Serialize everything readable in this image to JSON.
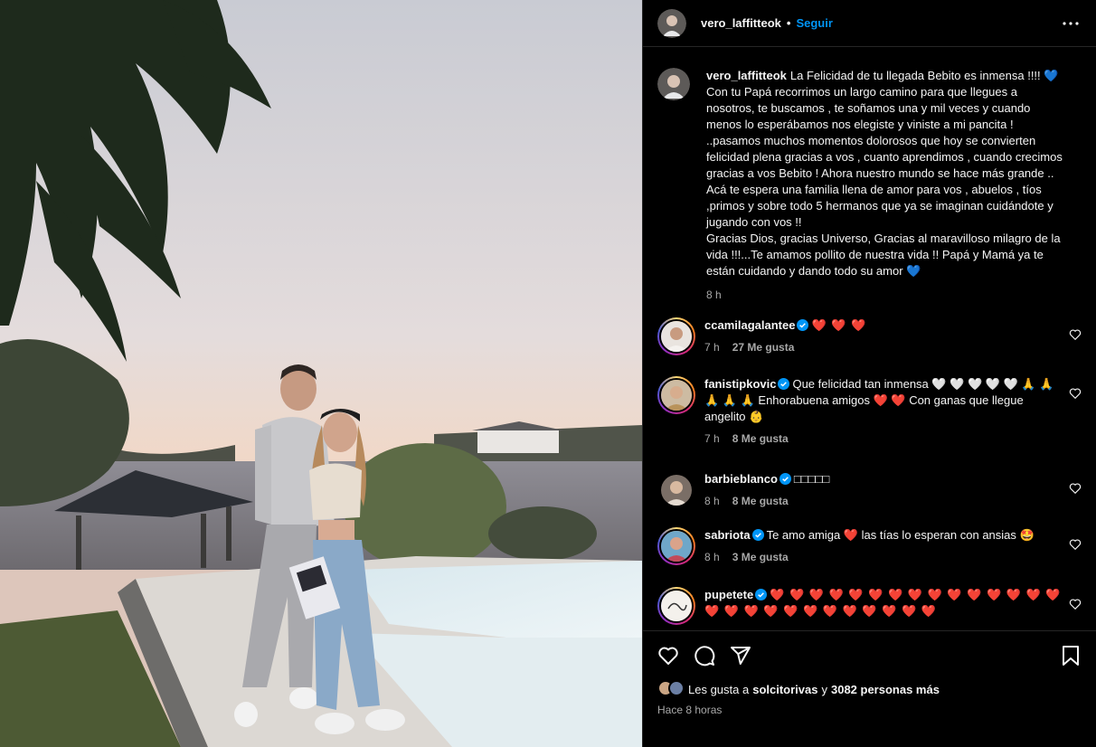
{
  "post": {
    "author": "vero_laffitteok",
    "follow_label": "Seguir",
    "separator": "•",
    "caption_lines": [
      "La Felicidad de tu llegada Bebito es inmensa !!!! 💙",
      "Con tu Papá recorrimos un largo camino para que llegues a",
      "nosotros, te buscamos , te soñamos una y mil veces y cuando",
      "menos lo esperábamos nos elegiste y viniste a mi pancita !",
      "..pasamos muchos momentos dolorosos que hoy se convierten",
      "felicidad plena gracias a vos , cuanto aprendimos , cuando crecimos",
      "gracias a vos Bebito ! Ahora nuestro mundo se hace más grande ..",
      "Acá te espera una familia llena de amor para vos , abuelos , tíos",
      ",primos y sobre todo 5 hermanos que ya se imaginan cuidándote y",
      "jugando con vos !!",
      "Gracias Dios, gracias Universo, Gracias al maravilloso milagro de la",
      "vida !!!...Te amamos pollito de nuestra vida !! Papá y Mamá ya te",
      "están cuidando y dando todo su amor 💙"
    ],
    "caption_time": "8 h"
  },
  "comments": [
    {
      "user": "ccamilagalantee",
      "verified": true,
      "text": "❤️ ❤️ ❤️",
      "time": "7 h",
      "likes": "27 Me gusta"
    },
    {
      "user": "fanistipkovic",
      "verified": true,
      "text": "Que felicidad tan inmensa 🤍 🤍 🤍 🤍 🤍 🙏 🙏 🙏 🙏 🙏 Enhorabuena amigos ❤️ ❤️ Con ganas que llegue angelito 👶",
      "time": "7 h",
      "likes": "8 Me gusta"
    },
    {
      "user": "barbieblanco",
      "verified": true,
      "text": "□□□□□",
      "time": "8 h",
      "likes": "8 Me gusta"
    },
    {
      "user": "sabriota",
      "verified": true,
      "text": "Te amo amiga ❤️ las tías lo esperan con ansias 🤩",
      "time": "8 h",
      "likes": "3 Me gusta"
    },
    {
      "user": "pupetete",
      "verified": true,
      "text": "❤️ ❤️ ❤️ ❤️ ❤️ ❤️ ❤️ ❤️ ❤️ ❤️ ❤️ ❤️ ❤️ ❤️ ❤️ ❤️ ❤️ ❤️ ❤️ ❤️ ❤️ ❤️ ❤️ ❤️ ❤️ ❤️ ❤️",
      "time": "",
      "likes": ""
    }
  ],
  "footer": {
    "likes_prefix": "Les gusta a ",
    "likes_user": "solcitorivas",
    "likes_middle": " y ",
    "likes_count": "3082 personas más",
    "posted_ago": "Hace 8 horas"
  },
  "icons": {
    "more": "more-horizontal-icon",
    "like": "heart-icon",
    "comment": "comment-icon",
    "share": "share-icon",
    "save": "bookmark-icon",
    "verified": "verified-badge-icon"
  },
  "colors": {
    "accent": "#0095f6",
    "heart": "#ed4956",
    "verified": "#0095f6",
    "muted": "#a8a8a8"
  }
}
